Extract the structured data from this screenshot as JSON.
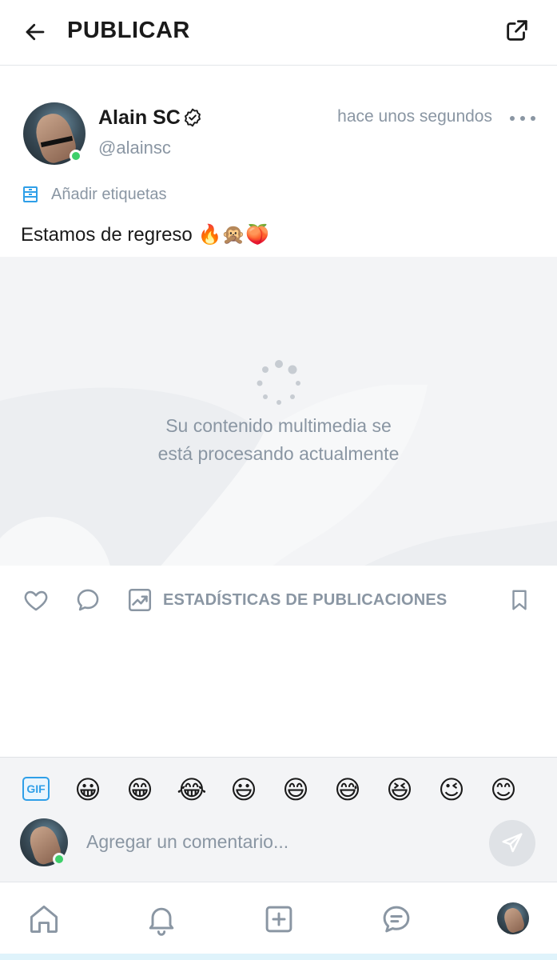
{
  "header": {
    "title": "PUBLICAR",
    "back_icon": "arrow-left-icon",
    "share_icon": "share-icon"
  },
  "post": {
    "author_name": "Alain SC",
    "author_handle": "@alainsc",
    "verified_icon": "verified-badge-icon",
    "timestamp": "hace unos segundos",
    "tags_label": "Añadir etiquetas",
    "text": "Estamos de regreso 🔥🙊🍑",
    "media_status_line1": "Su contenido multimedia se",
    "media_status_line2": "está procesando actualmente"
  },
  "actions": {
    "stats_label": "ESTADÍSTICAS DE PUBLICACIONES"
  },
  "comment": {
    "gif_label": "GIF",
    "emojis": [
      "😀",
      "😁",
      "😂",
      "😃",
      "😄",
      "😅",
      "😆",
      "😉",
      "😊"
    ],
    "placeholder": "Agregar un comentario..."
  },
  "colors": {
    "accent": "#2f9fe8",
    "muted": "#8a96a3",
    "online": "#3ecf6a",
    "media_bg": "#f3f4f6"
  }
}
